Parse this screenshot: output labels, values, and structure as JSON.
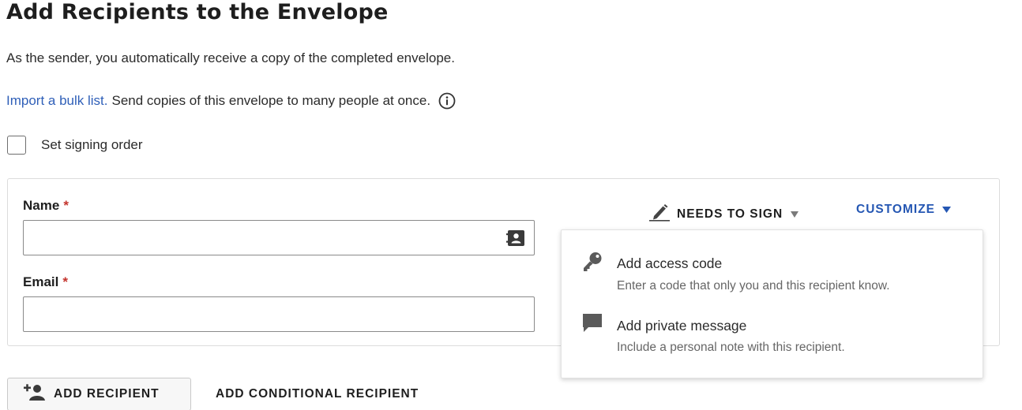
{
  "header": {
    "title": "Add Recipients to the Envelope",
    "subtitle": "As the sender, you automatically receive a copy of the completed envelope."
  },
  "bulk": {
    "link_label": "Import a bulk list.",
    "text": "Send copies of this envelope to many people at once.",
    "info_icon": "info-circle-icon"
  },
  "signing_order": {
    "label": "Set signing order",
    "checked": false
  },
  "recipient": {
    "name_label": "Name",
    "email_label": "Email",
    "required_mark": "*",
    "name_value": "",
    "email_value": "",
    "contacts_icon": "address-book-icon",
    "action": {
      "label": "NEEDS TO SIGN",
      "icon": "pen-icon"
    },
    "customize_label": "CUSTOMIZE",
    "accent_color": "#2557b3"
  },
  "customize_menu": {
    "items": [
      {
        "icon": "key-icon",
        "title": "Add access code",
        "description": "Enter a code that only you and this recipient know."
      },
      {
        "icon": "speech-bubble-icon",
        "title": "Add private message",
        "description": "Include a personal note with this recipient."
      }
    ]
  },
  "footer": {
    "add_recipient_label": "ADD RECIPIENT",
    "add_conditional_label": "ADD CONDITIONAL RECIPIENT",
    "add_recipient_icon": "add-person-icon"
  },
  "colors": {
    "link": "#2f5fb8",
    "required": "#c4342d"
  }
}
